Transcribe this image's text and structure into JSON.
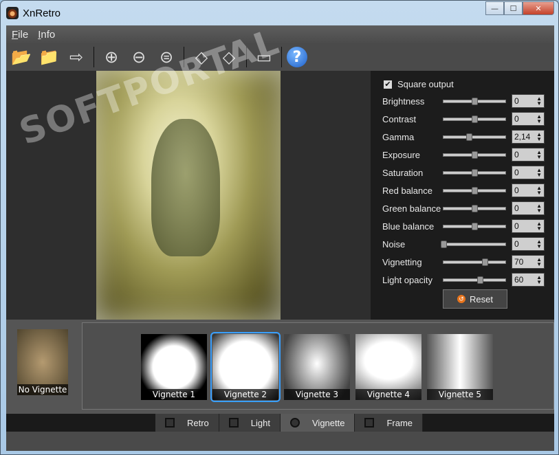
{
  "window": {
    "title": "XnRetro",
    "minimize": "—",
    "maximize": "☐",
    "close": "✕"
  },
  "menu": [
    "File",
    "Info"
  ],
  "toolbar": [
    {
      "icon": "open-icon",
      "glyph": "📂"
    },
    {
      "icon": "save-icon",
      "glyph": "📁"
    },
    {
      "icon": "export-icon",
      "glyph": "⇨"
    },
    {
      "icon": "zoom-in-icon",
      "glyph": "⊕"
    },
    {
      "icon": "zoom-out-icon",
      "glyph": "⊖"
    },
    {
      "icon": "zoom-fit-icon",
      "glyph": "⊜"
    },
    {
      "icon": "rotate-left-icon",
      "glyph": "◇"
    },
    {
      "icon": "rotate-right-icon",
      "glyph": "◇"
    },
    {
      "icon": "fullscreen-icon",
      "glyph": "▭"
    }
  ],
  "help_glyph": "?",
  "watermark": "SOFTPORTAL",
  "panel": {
    "square_output": {
      "label": "Square output",
      "checked": true
    },
    "adjustments": [
      {
        "label": "Brightness",
        "value": "0",
        "pos": 0.5
      },
      {
        "label": "Contrast",
        "value": "0",
        "pos": 0.5
      },
      {
        "label": "Gamma",
        "value": "2,14",
        "pos": 0.41
      },
      {
        "label": "Exposure",
        "value": "0",
        "pos": 0.5
      },
      {
        "label": "Saturation",
        "value": "0",
        "pos": 0.5
      },
      {
        "label": "Red balance",
        "value": "0",
        "pos": 0.5
      },
      {
        "label": "Green balance",
        "value": "0",
        "pos": 0.5
      },
      {
        "label": "Blue balance",
        "value": "0",
        "pos": 0.5
      },
      {
        "label": "Noise",
        "value": "0",
        "pos": 0.0
      },
      {
        "label": "Vignetting",
        "value": "70",
        "pos": 0.67
      },
      {
        "label": "Light opacity",
        "value": "60",
        "pos": 0.59
      }
    ],
    "reset": "Reset"
  },
  "presets": {
    "none": "No Vignette",
    "items": [
      "Vignette 1",
      "Vignette 2",
      "Vignette 3",
      "Vignette 4",
      "Vignette 5"
    ],
    "selected": 1
  },
  "tabs": [
    {
      "label": "Retro",
      "icon": "magic-wand-icon"
    },
    {
      "label": "Light",
      "icon": "light-icon"
    },
    {
      "label": "Vignette",
      "icon": "vignette-icon"
    },
    {
      "label": "Frame",
      "icon": "frame-icon"
    }
  ],
  "active_tab": 2,
  "colors": {
    "accent": "#3aa0ff",
    "panel": "#1c1c1c"
  }
}
